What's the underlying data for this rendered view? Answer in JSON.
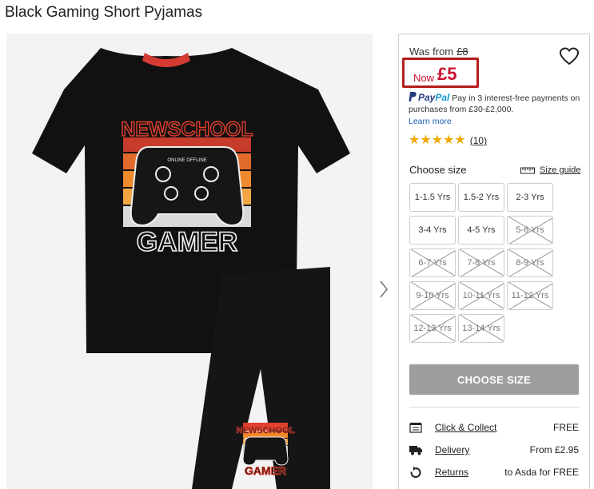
{
  "page": {
    "title": "Black Gaming Short Pyjamas"
  },
  "gallery": {
    "tee_print_top": "NEWSCHOOL",
    "tee_print_bottom": "GAMER",
    "controller_text": "ONLINE OFFLINE",
    "shorts_print_top": "NEWSCHOOL",
    "shorts_print_bottom": "GAMER",
    "next_icon": "chevron-right-icon"
  },
  "price": {
    "was_label": "Was from",
    "was_price": "£8",
    "now_label": "Now",
    "now_price": "£5",
    "highlight_color": "#b51c1c",
    "price_color": "#c8102e"
  },
  "wishlist": {
    "icon": "heart-icon"
  },
  "paypal": {
    "brand_pay": "Pay",
    "brand_pal": "Pal",
    "text": "Pay in 3 interest-free payments on purchases from £30-£2,000.",
    "learn_more": "Learn more"
  },
  "rating": {
    "stars": 5,
    "review_count": "(10)"
  },
  "size": {
    "label": "Choose size",
    "guide_label": "Size guide",
    "options": [
      {
        "label": "1-1.5 Yrs",
        "available": true
      },
      {
        "label": "1.5-2 Yrs",
        "available": true
      },
      {
        "label": "2-3 Yrs",
        "available": true
      },
      {
        "label": "3-4 Yrs",
        "available": true
      },
      {
        "label": "4-5 Yrs",
        "available": true
      },
      {
        "label": "5-6 Yrs",
        "available": false
      },
      {
        "label": "6-7 Yrs",
        "available": false
      },
      {
        "label": "7-8 Yrs",
        "available": false
      },
      {
        "label": "8-9 Yrs",
        "available": false
      },
      {
        "label": "9-10 Yrs",
        "available": false
      },
      {
        "label": "10-11 Yrs",
        "available": false
      },
      {
        "label": "11-12 Yrs",
        "available": false
      },
      {
        "label": "12-13 Yrs",
        "available": false
      },
      {
        "label": "13-14 Yrs",
        "available": false
      }
    ]
  },
  "cta": {
    "label": "CHOOSE SIZE"
  },
  "delivery": [
    {
      "icon": "store-icon",
      "label": "Click & Collect",
      "value": "FREE"
    },
    {
      "icon": "truck-icon",
      "label": "Delivery",
      "value": "From £2.95"
    },
    {
      "icon": "return-icon",
      "label": "Returns",
      "value": "to Asda for FREE"
    }
  ]
}
